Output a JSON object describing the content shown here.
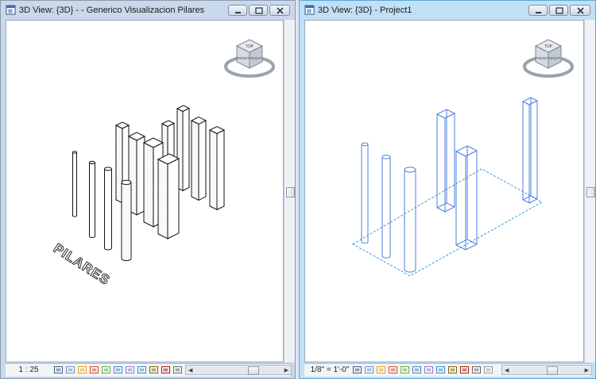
{
  "windows": [
    {
      "title": "3D View: {3D} - - Generico Visualizacion Pilares",
      "scale": "1 : 25",
      "canvas_text": "PILARES",
      "viewcube_faces": [
        "TOP",
        "FRONT",
        "RIGHT"
      ],
      "view_color": "#111111"
    },
    {
      "title": "3D View: {3D} - Project1",
      "scale": "1/8\" = 1'-0\"",
      "viewcube_faces": [
        "TOP",
        "FRONT",
        "RIGHT"
      ],
      "view_color": "#4a7fe0"
    }
  ],
  "view_control_icons": [
    "detail-level-icon",
    "visual-style-icon",
    "sun-path-icon",
    "shadows-icon",
    "crop-view-icon",
    "show-crop-icon",
    "temporary-hide-icon",
    "reveal-hidden-icon",
    "lock-3d-view-icon",
    "analytical-model-icon",
    "highlight-displacement-icon",
    "render-icon"
  ]
}
